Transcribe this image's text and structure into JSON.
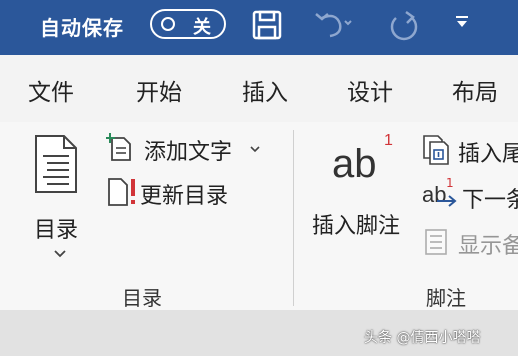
{
  "quick_access": {
    "autosave_label": "自动保存",
    "autosave_state": "关",
    "icons": [
      "save-icon",
      "undo-icon",
      "redo-icon",
      "customize-dropdown-icon"
    ]
  },
  "tabs": [
    {
      "label": "文件"
    },
    {
      "label": "开始"
    },
    {
      "label": "插入"
    },
    {
      "label": "设计"
    },
    {
      "label": "布局"
    }
  ],
  "groups": {
    "toc": {
      "label": "目录",
      "toc_button_label": "目录",
      "add_text_label": "添加文字",
      "update_toc_label": "更新目录"
    },
    "footnotes": {
      "label": "脚注",
      "insert_footnote_label": "插入脚注",
      "insert_endnote_label": "插入尾",
      "next_footnote_label": "下一条",
      "show_notes_label": "显示备"
    }
  },
  "footnote_icon_text": {
    "main": "ab",
    "superscript": "1",
    "small_main": "ab",
    "small_super": "1"
  },
  "watermark": "头条 @倩西小嗒嗒",
  "colors": {
    "title_bar": "#2b579a",
    "accent_red": "#d13438",
    "accent_blue": "#2b579a"
  }
}
